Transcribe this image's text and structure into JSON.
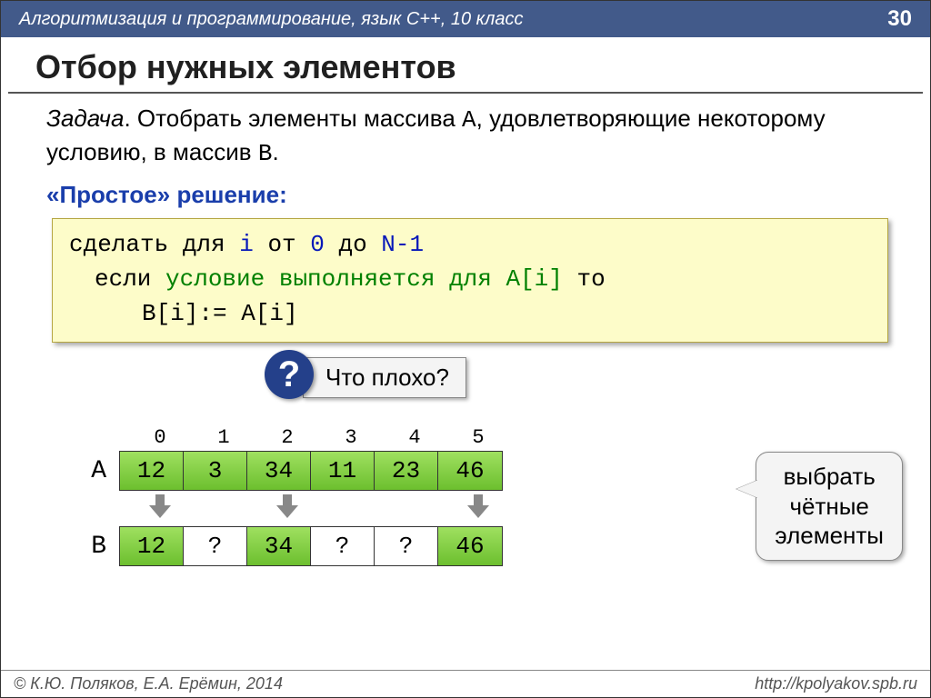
{
  "header": {
    "course": "Алгоритмизация и программирование, язык С++, 10 класс",
    "page": "30"
  },
  "title": "Отбор нужных элементов",
  "task": {
    "label": "Задача",
    "text_before": ". Отобрать элементы массива ",
    "arrA": "A",
    "text_mid": ", удовлетворяющие некоторому условию, в массив ",
    "arrB": "B",
    "text_after": "."
  },
  "subheading": "«Простое» решение:",
  "code": {
    "l1a": "сделать для ",
    "l1b": "i",
    "l1c": " от ",
    "l1d": "0",
    "l1e": " до ",
    "l1f": "N-1",
    "l2a": "если ",
    "l2b": "условие выполняется для A[i]",
    "l2c": " то",
    "l3": "B[i]:= A[i]"
  },
  "question": {
    "mark": "?",
    "text": "Что плохо?"
  },
  "indices": [
    "0",
    "1",
    "2",
    "3",
    "4",
    "5"
  ],
  "arrayA": {
    "label": "A",
    "cells": [
      {
        "v": "12",
        "c": "greenA"
      },
      {
        "v": "3",
        "c": "greenA"
      },
      {
        "v": "34",
        "c": "greenA"
      },
      {
        "v": "11",
        "c": "greenA"
      },
      {
        "v": "23",
        "c": "greenA"
      },
      {
        "v": "46",
        "c": "greenA"
      }
    ]
  },
  "arrows": [
    true,
    false,
    true,
    false,
    false,
    true
  ],
  "arrayB": {
    "label": "B",
    "cells": [
      {
        "v": "12",
        "c": "greenA"
      },
      {
        "v": "?",
        "c": "white"
      },
      {
        "v": "34",
        "c": "greenA"
      },
      {
        "v": "?",
        "c": "white"
      },
      {
        "v": "?",
        "c": "white"
      },
      {
        "v": "46",
        "c": "greenA"
      }
    ]
  },
  "speech": {
    "l1": "выбрать",
    "l2": "чётные",
    "l3": "элементы"
  },
  "footer": {
    "left": "© К.Ю. Поляков, Е.А. Ерёмин, 2014",
    "right": "http://kpolyakov.spb.ru"
  }
}
